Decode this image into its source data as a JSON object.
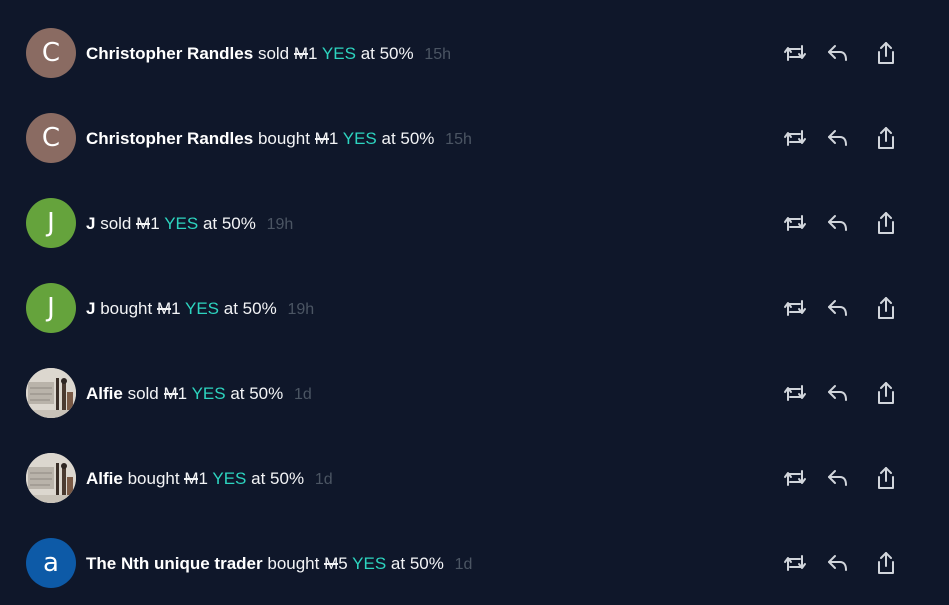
{
  "feed": [
    {
      "user": "Christopher Randles",
      "action": "sold",
      "amount": "1",
      "outcome": "YES",
      "price": "at 50%",
      "time": "15h",
      "avatar": {
        "type": "letter",
        "letter": "C",
        "color": "#8a6b62"
      }
    },
    {
      "user": "Christopher Randles",
      "action": "bought",
      "amount": "1",
      "outcome": "YES",
      "price": "at 50%",
      "time": "15h",
      "avatar": {
        "type": "letter",
        "letter": "C",
        "color": "#8a6b62"
      }
    },
    {
      "user": "J",
      "action": "sold",
      "amount": "1",
      "outcome": "YES",
      "price": "at 50%",
      "time": "19h",
      "avatar": {
        "type": "letter",
        "letter": "J",
        "color": "#65a33c"
      }
    },
    {
      "user": "J",
      "action": "bought",
      "amount": "1",
      "outcome": "YES",
      "price": "at 50%",
      "time": "19h",
      "avatar": {
        "type": "letter",
        "letter": "J",
        "color": "#65a33c"
      }
    },
    {
      "user": "Alfie",
      "action": "sold",
      "amount": "1",
      "outcome": "YES",
      "price": "at 50%",
      "time": "1d",
      "avatar": {
        "type": "image"
      }
    },
    {
      "user": "Alfie",
      "action": "bought",
      "amount": "1",
      "outcome": "YES",
      "price": "at 50%",
      "time": "1d",
      "avatar": {
        "type": "image"
      }
    },
    {
      "user": "The Nth unique trader",
      "action": "bought",
      "amount": "5",
      "outcome": "YES",
      "price": "at 50%",
      "time": "1d",
      "avatar": {
        "type": "letter",
        "letter": "a",
        "color": "#0d5aa7"
      }
    }
  ],
  "currency_symbol": "M",
  "colors": {
    "background": "#0f172a",
    "outcome_yes": "#2dd4bf",
    "timestamp": "#4b5563",
    "icon": "#d1d5db"
  },
  "actions": [
    "repost-icon",
    "reply-icon",
    "share-icon"
  ]
}
